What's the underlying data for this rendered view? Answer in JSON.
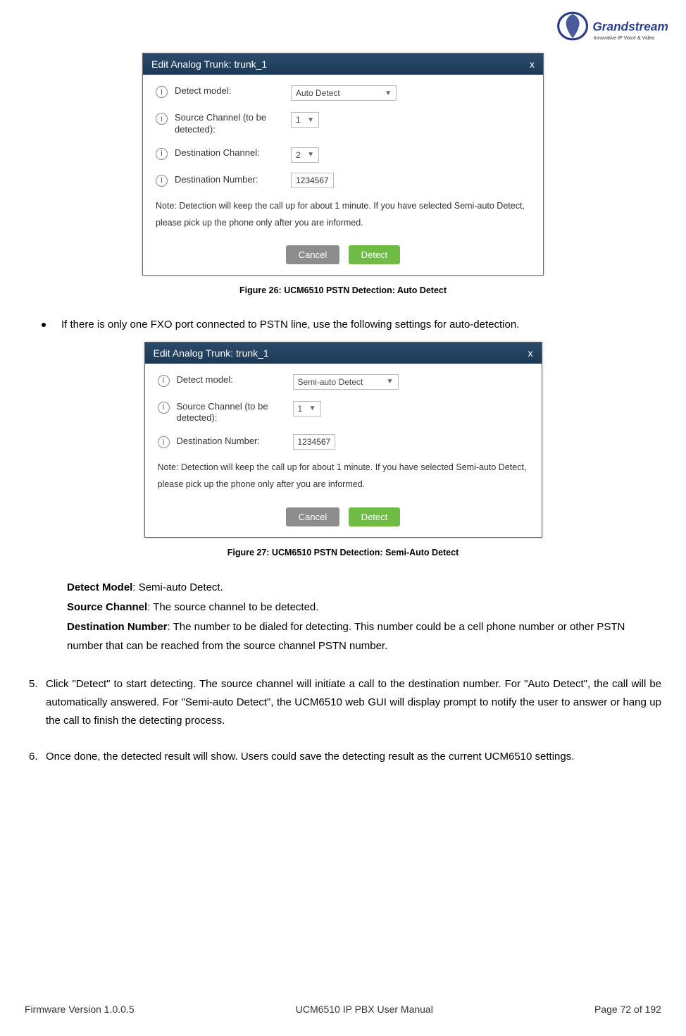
{
  "logo": {
    "brand_top": "Grandstream",
    "tagline": "Innovative IP Voice & Video"
  },
  "dialog1": {
    "title": "Edit Analog Trunk: trunk_1",
    "close": "x",
    "rows": {
      "detect_model_label": "Detect model:",
      "detect_model_value": "Auto Detect",
      "source_channel_label": "Source Channel (to be detected):",
      "source_channel_value": "1",
      "dest_channel_label": "Destination Channel:",
      "dest_channel_value": "2",
      "dest_number_label": "Destination Number:",
      "dest_number_value": "1234567"
    },
    "note": "Note: Detection will keep the call up for about 1 minute. If you have selected Semi-auto Detect, please pick up the phone only after you are informed.",
    "btn_cancel": "Cancel",
    "btn_detect": "Detect"
  },
  "caption1": "Figure 26: UCM6510 PSTN Detection: Auto Detect",
  "bullet1": "If there is only one FXO port connected to PSTN line, use the following settings for auto-detection.",
  "dialog2": {
    "title": "Edit Analog Trunk: trunk_1",
    "close": "x",
    "rows": {
      "detect_model_label": "Detect model:",
      "detect_model_value": "Semi-auto Detect",
      "source_channel_label": "Source Channel (to be detected):",
      "source_channel_value": "1",
      "dest_number_label": "Destination Number:",
      "dest_number_value": "1234567"
    },
    "note": "Note: Detection will keep the call up for about 1 minute. If you have selected Semi-auto Detect, please pick up the phone only after you are informed.",
    "btn_cancel": "Cancel",
    "btn_detect": "Detect"
  },
  "caption2": "Figure 27: UCM6510 PSTN Detection: Semi-Auto Detect",
  "defs": {
    "l1_bold": "Detect Model",
    "l1_rest": ": Semi-auto Detect.",
    "l2_bold": "Source Channel",
    "l2_rest": ": The source channel to be detected.",
    "l3_bold": "Destination Number",
    "l3_rest": ": The number to be dialed for detecting. This number could be a cell phone number or other PSTN number that can be reached from the source channel PSTN number."
  },
  "steps": {
    "n5": "5.",
    "t5": "Click \"Detect\" to start detecting. The source channel will initiate a call to the destination number. For \"Auto Detect\", the call will be automatically answered. For \"Semi-auto Detect\", the UCM6510 web GUI will display prompt to notify the user to answer or hang up the call to finish the detecting process.",
    "n6": "6.",
    "t6": "Once done, the detected result will show. Users could save the detecting result as the current UCM6510 settings."
  },
  "footer": {
    "left": "Firmware Version 1.0.0.5",
    "center": "UCM6510 IP PBX User Manual",
    "right": "Page 72 of 192"
  }
}
